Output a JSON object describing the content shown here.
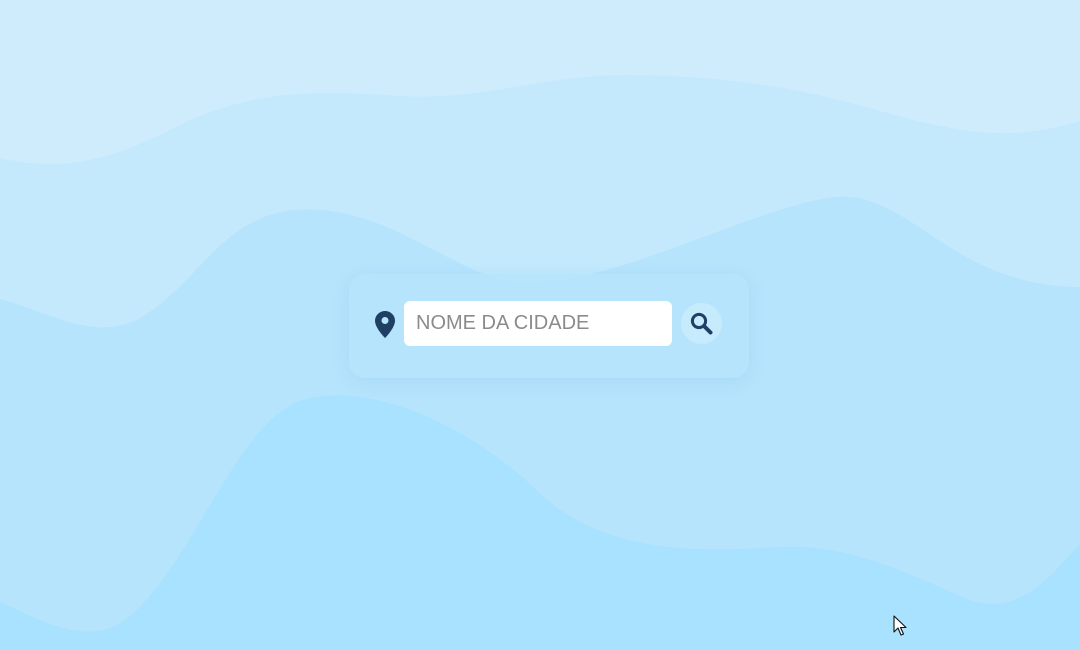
{
  "search": {
    "placeholder": "NOME DA CIDADE",
    "value": ""
  },
  "icons": {
    "location": "location-pin-icon",
    "search": "search-icon",
    "cursor": "mouse-cursor-icon"
  },
  "colors": {
    "background_light": "#cfecfd",
    "background_mid": "#bfe7fc",
    "background_deep": "#a9e2fe",
    "icon": "#1f3f65",
    "input_background": "#ffffff",
    "placeholder": "#8b8b8b"
  }
}
